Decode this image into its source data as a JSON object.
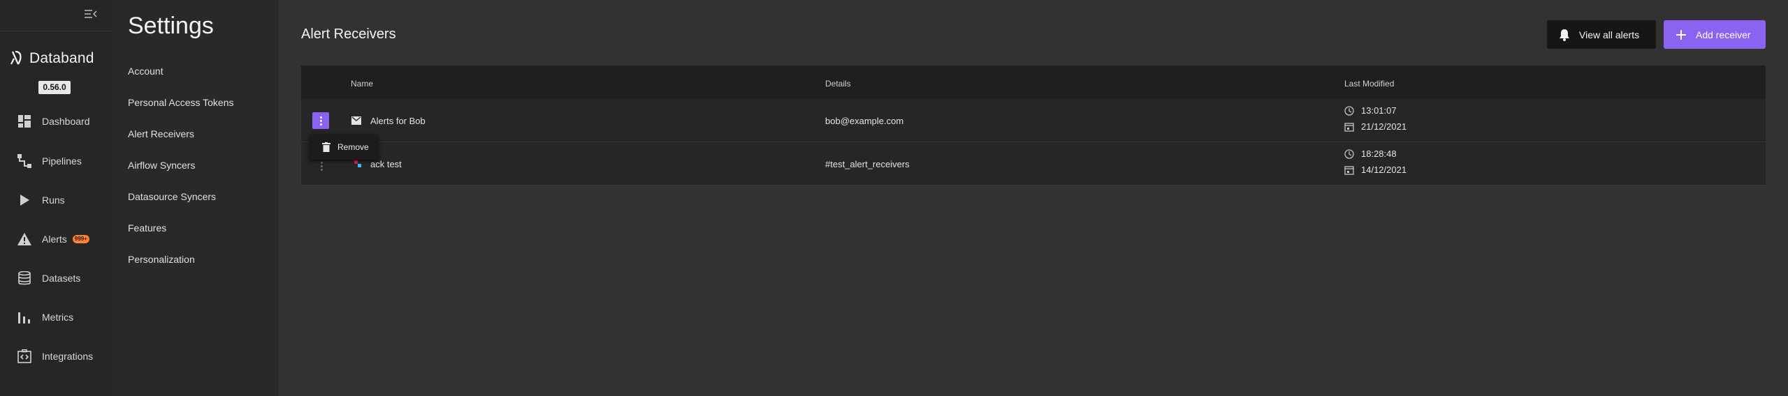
{
  "nav": {
    "brand": "Databand",
    "version": "0.56.0",
    "items": [
      {
        "label": "Dashboard",
        "icon": "dashboard-icon"
      },
      {
        "label": "Pipelines",
        "icon": "pipelines-icon"
      },
      {
        "label": "Runs",
        "icon": "play-icon"
      },
      {
        "label": "Alerts",
        "icon": "warning-icon",
        "badge": "999+"
      },
      {
        "label": "Datasets",
        "icon": "database-icon"
      },
      {
        "label": "Metrics",
        "icon": "bar-chart-icon"
      },
      {
        "label": "Integrations",
        "icon": "integrations-icon"
      }
    ]
  },
  "settings": {
    "title": "Settings",
    "items": [
      "Account",
      "Personal Access Tokens",
      "Alert Receivers",
      "Airflow Syncers",
      "Datasource Syncers",
      "Features",
      "Personalization"
    ]
  },
  "main": {
    "title": "Alert Receivers",
    "view_all_label": "View all alerts",
    "add_label": "Add receiver",
    "columns": {
      "name": "Name",
      "details": "Details",
      "last_modified": "Last Modified"
    },
    "rows": [
      {
        "name": "Alerts for Bob",
        "details": "bob@example.com",
        "time": "13:01:07",
        "date": "21/12/2021",
        "type_icon": "email-icon"
      },
      {
        "name": "ack test",
        "details": "#test_alert_receivers",
        "time": "18:28:48",
        "date": "14/12/2021",
        "type_icon": "slack-icon"
      }
    ],
    "context_menu": {
      "remove_label": "Remove"
    }
  },
  "colors": {
    "accent": "#8a63f0",
    "badge": "#ff832b"
  }
}
